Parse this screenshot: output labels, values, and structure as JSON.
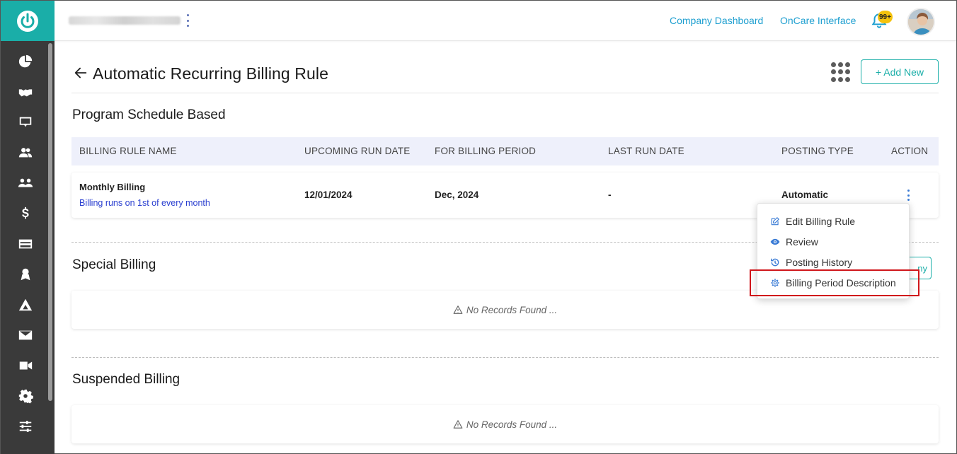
{
  "topbar": {
    "company_dashboard": "Company Dashboard",
    "oncare_interface": "OnCare Interface",
    "notification_badge": "99+"
  },
  "sidebar": {
    "items": [
      "dashboard-icon",
      "handshake-icon",
      "monitor-icon",
      "users-icon",
      "group-icon",
      "dollar-icon",
      "card-icon",
      "award-icon",
      "camp-icon",
      "mail-icon",
      "video-icon",
      "gear-icon",
      "sliders-icon"
    ]
  },
  "page": {
    "title": "Automatic Recurring Billing Rule",
    "add_new_label": "+ Add New"
  },
  "program_schedule": {
    "title": "Program Schedule Based",
    "columns": [
      "BILLING RULE NAME",
      "UPCOMING RUN DATE",
      "FOR BILLING PERIOD",
      "LAST RUN DATE",
      "POSTING TYPE",
      "ACTION"
    ],
    "row": {
      "name": "Monthly Billing",
      "description": "Billing runs on 1st of every month",
      "upcoming_run_date": "12/01/2024",
      "billing_period": "Dec, 2024",
      "last_run_date": "-",
      "posting_type": "Automatic"
    }
  },
  "special_billing": {
    "title": "Special Billing",
    "empty_text": "No Records Found ...",
    "partial_button": "ny"
  },
  "suspended_billing": {
    "title": "Suspended Billing",
    "empty_text": "No Records Found ..."
  },
  "action_menu": {
    "edit": "Edit Billing Rule",
    "review": "Review",
    "posting_history": "Posting History",
    "period_description": "Billing Period Description"
  },
  "colors": {
    "accent": "#1aaea8",
    "sidebar": "#3a3a3a",
    "link": "#1e9fd0",
    "highlight": "#d0161b",
    "header_bg": "#eef0fb"
  }
}
